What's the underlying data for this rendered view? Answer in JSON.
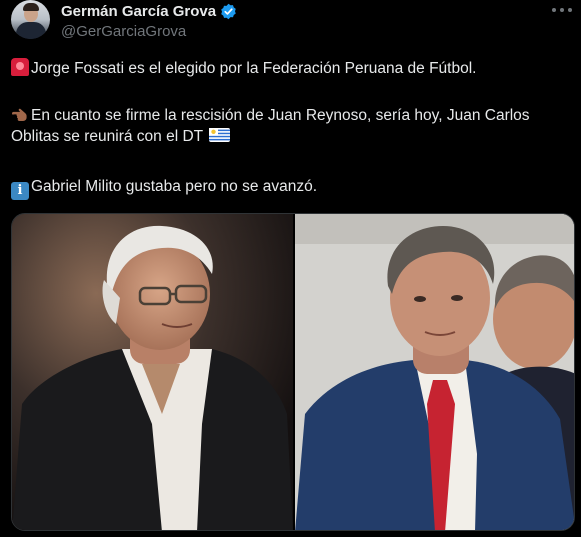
{
  "author": {
    "display_name": "Germán García Grova",
    "handle": "@GerGarciaGrova",
    "verified": true
  },
  "tweet": {
    "line1": "Jorge Fossati es el elegido por la Federación Peruana de Fútbol.",
    "line2": "En cuanto se firme la rescisión de Juan Reynoso, sería hoy, Juan Carlos Oblitas se reunirá con el DT",
    "line3": "Gabriel Milito gustaba pero no se avanzó.",
    "emojis": [
      "siren-icon",
      "pointing-left-icon",
      "uruguay-flag-icon",
      "info-icon"
    ]
  },
  "colors": {
    "background": "#000000",
    "text": "#e7e9ea",
    "muted": "#71767b",
    "verified": "#1d9bf0"
  }
}
